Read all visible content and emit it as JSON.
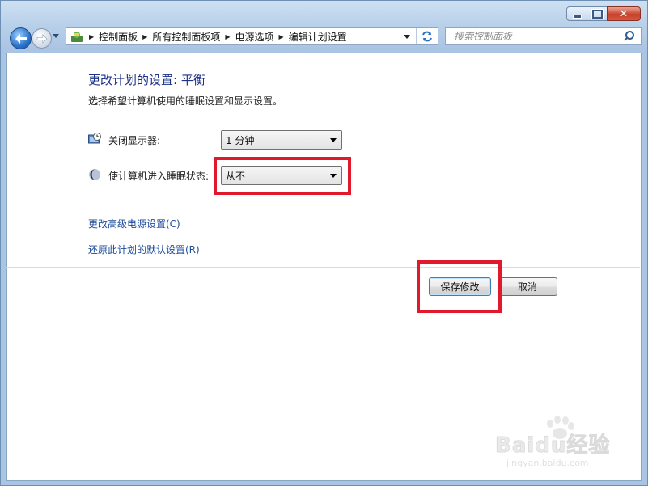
{
  "window": {
    "buttons": {
      "minimize": "minimize",
      "maximize": "maximize",
      "close": "close"
    }
  },
  "address_bar": {
    "crumbs": [
      "控制面板",
      "所有控制面板项",
      "电源选项",
      "编辑计划设置"
    ]
  },
  "search": {
    "placeholder": "搜索控制面板"
  },
  "content": {
    "title": "更改计划的设置: 平衡",
    "subtitle": "选择希望计算机使用的睡眠设置和显示设置。",
    "display_off": {
      "label": "关闭显示器:",
      "value": "1 分钟"
    },
    "sleep": {
      "label": "使计算机进入睡眠状态:",
      "value": "从不"
    },
    "links": {
      "advanced": "更改高级电源设置(C)",
      "restore": "还原此计划的默认设置(R)"
    },
    "buttons": {
      "save": "保存修改",
      "cancel": "取消"
    }
  },
  "watermark": {
    "brand": "Baidu经验",
    "url": "jingyan.baidu.com"
  },
  "colors": {
    "title": "#1e3287",
    "link": "#1f4c9d",
    "highlight": "#e0192d",
    "accent": "#2b73c9"
  },
  "icons": {
    "back": "back-arrow-icon",
    "forward": "forward-arrow-icon",
    "control_panel": "control-panel-icon",
    "refresh": "refresh-icon",
    "search": "search-icon",
    "display": "monitor-clock-icon",
    "sleep": "moon-icon"
  }
}
